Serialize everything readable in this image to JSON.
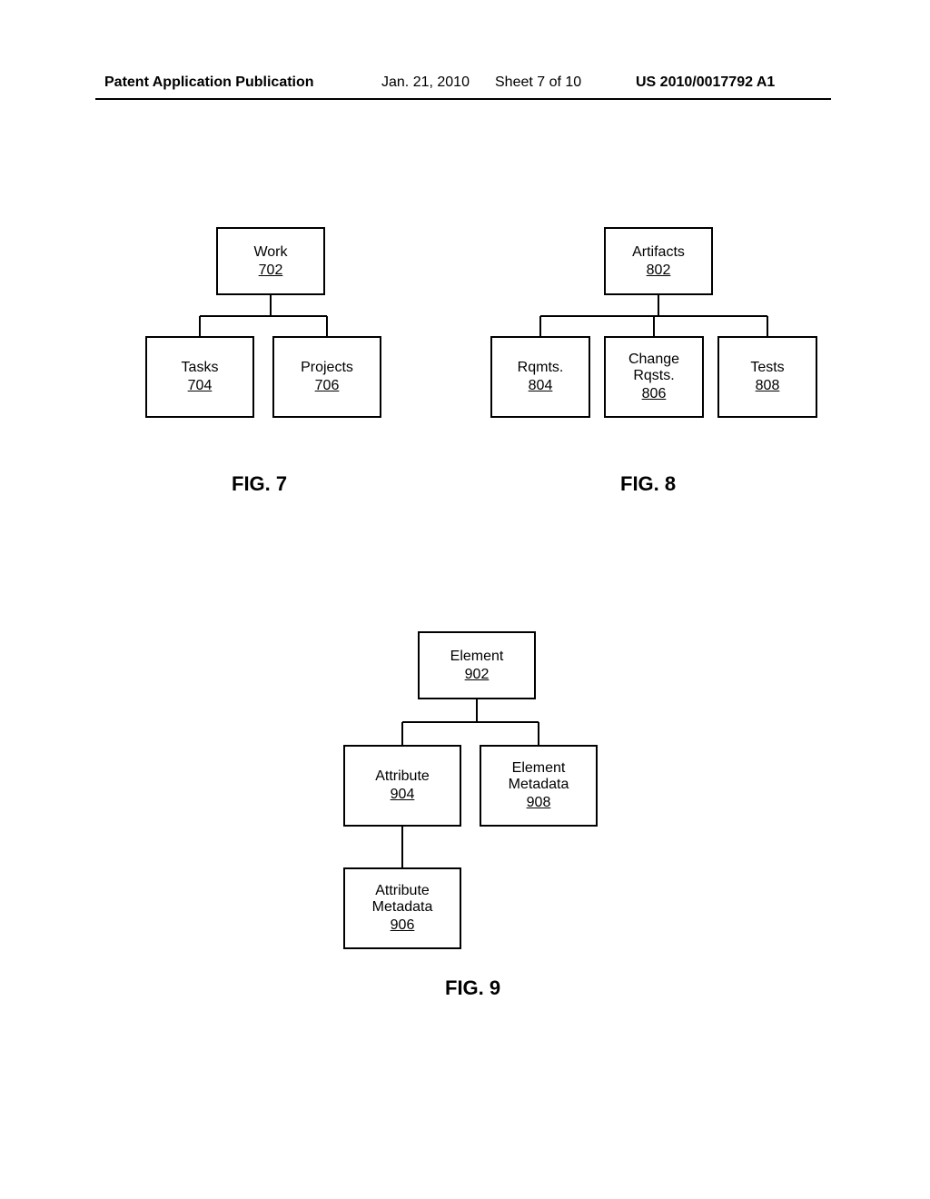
{
  "header": {
    "left": "Patent Application Publication",
    "date": "Jan. 21, 2010",
    "sheet": "Sheet 7 of 10",
    "pub": "US 2010/0017792 A1"
  },
  "fig7": {
    "label": "FIG. 7",
    "work": {
      "title": "Work",
      "ref": "702"
    },
    "tasks": {
      "title": "Tasks",
      "ref": "704"
    },
    "projects": {
      "title": "Projects",
      "ref": "706"
    }
  },
  "fig8": {
    "label": "FIG. 8",
    "artifacts": {
      "title": "Artifacts",
      "ref": "802"
    },
    "rqmts": {
      "title": "Rqmts.",
      "ref": "804"
    },
    "change": {
      "title": "Change Rqsts.",
      "ref": "806"
    },
    "tests": {
      "title": "Tests",
      "ref": "808"
    }
  },
  "fig9": {
    "label": "FIG. 9",
    "element": {
      "title": "Element",
      "ref": "902"
    },
    "attribute": {
      "title": "Attribute",
      "ref": "904"
    },
    "elmeta": {
      "title": "Element Metadata",
      "ref": "908"
    },
    "attrmeta": {
      "title": "Attribute Metadata",
      "ref": "906"
    }
  }
}
